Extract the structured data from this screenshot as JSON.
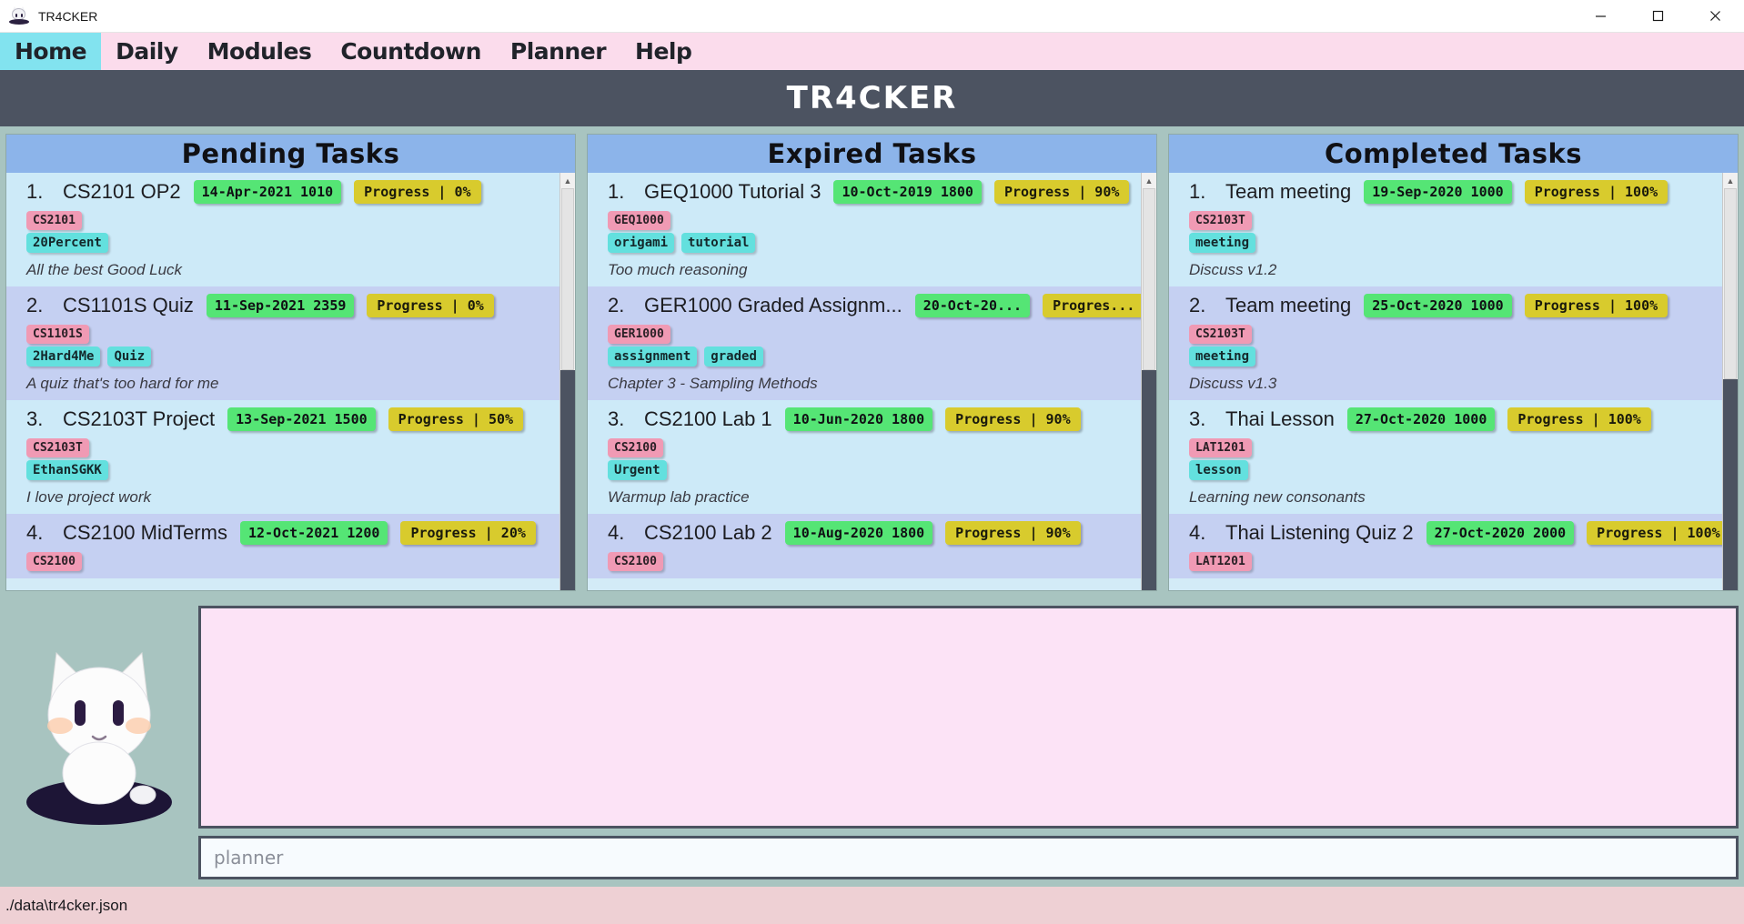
{
  "window": {
    "title": "TR4CKER",
    "app_icon": "cat-mascot-icon",
    "minimize_label": "—",
    "maximize_label": "□",
    "close_label": "✕"
  },
  "menubar": {
    "items": [
      {
        "label": "Home",
        "active": true
      },
      {
        "label": "Daily",
        "active": false
      },
      {
        "label": "Modules",
        "active": false
      },
      {
        "label": "Countdown",
        "active": false
      },
      {
        "label": "Planner",
        "active": false
      },
      {
        "label": "Help",
        "active": false
      }
    ]
  },
  "banner": {
    "title": "TR4CKER"
  },
  "columns": [
    {
      "id": "pending",
      "header": "Pending Tasks",
      "tasks": [
        {
          "index": "1.",
          "title": "CS2101 OP2",
          "date": "14-Apr-2021 1010",
          "progress": "Progress | 0%",
          "module": "CS2101",
          "tags": [
            "20Percent"
          ],
          "description": "All the best Good Luck"
        },
        {
          "index": "2.",
          "title": "CS1101S Quiz",
          "date": "11-Sep-2021 2359",
          "progress": "Progress | 0%",
          "module": "CS1101S",
          "tags": [
            "2Hard4Me",
            "Quiz"
          ],
          "description": "A quiz that's too hard for me"
        },
        {
          "index": "3.",
          "title": "CS2103T Project",
          "date": "13-Sep-2021 1500",
          "progress": "Progress | 50%",
          "module": "CS2103T",
          "tags": [
            "EthanSGKK"
          ],
          "description": "I love project work"
        },
        {
          "index": "4.",
          "title": "CS2100 MidTerms",
          "date": "12-Oct-2021 1200",
          "progress": "Progress | 20%",
          "module": "CS2100",
          "tags": [],
          "description": ""
        }
      ]
    },
    {
      "id": "expired",
      "header": "Expired Tasks",
      "tasks": [
        {
          "index": "1.",
          "title": "GEQ1000 Tutorial 3",
          "date": "10-Oct-2019 1800",
          "progress": "Progress | 90%",
          "module": "GEQ1000",
          "tags": [
            "origami",
            "tutorial"
          ],
          "description": "Too much reasoning"
        },
        {
          "index": "2.",
          "title": "GER1000 Graded Assignm...",
          "date": "20-Oct-20...",
          "progress": "Progres...",
          "module": "GER1000",
          "tags": [
            "assignment",
            "graded"
          ],
          "description": "Chapter 3 - Sampling Methods"
        },
        {
          "index": "3.",
          "title": "CS2100 Lab 1",
          "date": "10-Jun-2020 1800",
          "progress": "Progress | 90%",
          "module": "CS2100",
          "tags": [
            "Urgent"
          ],
          "description": "Warmup lab practice"
        },
        {
          "index": "4.",
          "title": "CS2100 Lab 2",
          "date": "10-Aug-2020 1800",
          "progress": "Progress | 90%",
          "module": "CS2100",
          "tags": [],
          "description": ""
        }
      ]
    },
    {
      "id": "completed",
      "header": "Completed Tasks",
      "tasks": [
        {
          "index": "1.",
          "title": "Team meeting",
          "date": "19-Sep-2020 1000",
          "progress": "Progress | 100%",
          "module": "CS2103T",
          "tags": [
            "meeting"
          ],
          "description": "Discuss v1.2"
        },
        {
          "index": "2.",
          "title": "Team meeting",
          "date": "25-Oct-2020 1000",
          "progress": "Progress | 100%",
          "module": "CS2103T",
          "tags": [
            "meeting"
          ],
          "description": "Discuss v1.3"
        },
        {
          "index": "3.",
          "title": "Thai Lesson",
          "date": "27-Oct-2020 1000",
          "progress": "Progress | 100%",
          "module": "LAT1201",
          "tags": [
            "lesson"
          ],
          "description": "Learning new consonants"
        },
        {
          "index": "4.",
          "title": "Thai Listening Quiz 2",
          "date": "27-Oct-2020 2000",
          "progress": "Progress | 100%",
          "module": "LAT1201",
          "tags": [],
          "description": ""
        }
      ]
    }
  ],
  "bottom": {
    "mascot_icon": "cat-mascot-illustration",
    "output_text": "",
    "planner_placeholder": "planner"
  },
  "statusbar": {
    "path": "./data\\tr4cker.json"
  },
  "colors": {
    "menubar_bg": "#fbdcec",
    "menu_active_bg": "#82e3ef",
    "banner_bg": "#4c5361",
    "column_header_bg": "#8cb4ea",
    "app_bg": "#a8c4c0",
    "row_odd_bg": "#cdeaf8",
    "row_even_bg": "#c5d0f2",
    "badge_date_bg": "#55e575",
    "badge_progress_bg": "#d8cb2d",
    "tag_module_bg": "#f09ab4",
    "tag_label_bg": "#63e0de",
    "output_bg": "#fce3f6",
    "statusbar_bg": "#eed0d4"
  }
}
